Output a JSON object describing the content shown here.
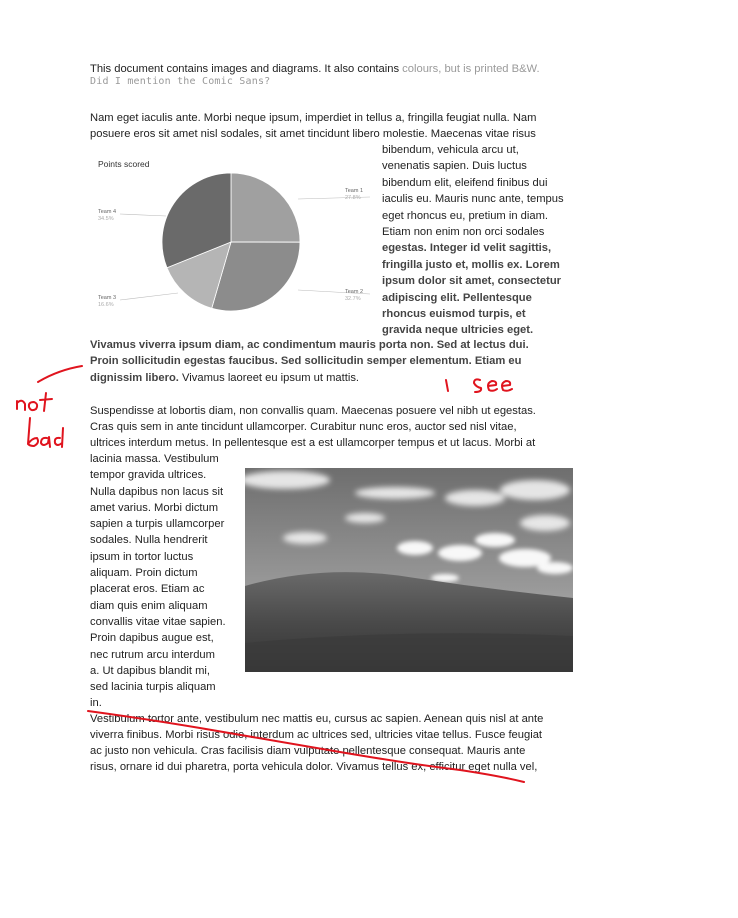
{
  "intro": {
    "line1_black": "This document contains images and diagrams. It also contains ",
    "line1_gray": "colours, but is printed B&W.",
    "line2": "Did I mention the Comic Sans?"
  },
  "para1": {
    "full_lines": [
      "Nam eget iaculis ante. Morbi neque ipsum, imperdiet in tellus a, fringilla feugiat nulla. Nam",
      "posuere eros sit amet nisl sodales, sit amet tincidunt libero molestie. Maecenas vitae risus"
    ],
    "wrap_lines": [
      "bibendum, vehicula arcu ut,",
      "venenatis sapien. Duis luctus",
      "bibendum elit, eleifend finibus dui",
      "iaculis eu. Mauris nunc ante, tempus",
      "eget rhoncus eu, pretium in diam.",
      "Etiam non enim non orci sodales",
      "egestas. Integer id velit sagittis,",
      "fringilla justo et, mollis ex. Lorem",
      "ipsum dolor sit amet, consectetur",
      "adipiscing elit. Pellentesque",
      "rhoncus euismod turpis, et",
      "gravida neque ultricies eget."
    ],
    "after_lines": [
      "Vivamus viverra ipsum diam, ac condimentum mauris porta non. Sed at lectus dui.",
      "Proin sollicitudin egestas faucibus. Sed sollicitudin semper elementum. Etiam eu"
    ],
    "last_bold": "dignissim libero.",
    "last_normal": " Vivamus laoreet eu ipsum ut mattis."
  },
  "chart_data": {
    "type": "pie",
    "title": "Points scored",
    "slices": [
      {
        "name": "Team 1",
        "value": 27.8,
        "label": "27.8%"
      },
      {
        "name": "Team 2",
        "value": 32.7,
        "label": "32.7%"
      },
      {
        "name": "Team 3",
        "value": 16.0,
        "label": "16.6%"
      },
      {
        "name": "Team 4",
        "value": 34.5,
        "label": "34.5%"
      }
    ],
    "colors": [
      "#a0a0a0",
      "#8c8c8c",
      "#b5b5b5",
      "#6a6a6a"
    ]
  },
  "para2": {
    "full_lines": [
      "Suspendisse at lobortis diam, non convallis quam. Maecenas posuere vel nibh ut egestas.",
      "Cras quis sem in ante tincidunt ullamcorper. Curabitur nunc eros, auctor sed nisl vitae,",
      "ultrices interdum metus. In pellentesque est a est ullamcorper tempus et ut lacus. Morbi at"
    ],
    "wrap_lines": [
      "lacinia massa. Vestibulum",
      "tempor gravida ultrices.",
      "Nulla dapibus non lacus sit",
      "amet varius. Morbi dictum",
      "sapien a turpis ullamcorper",
      "sodales. Nulla hendrerit",
      "ipsum in tortor luctus",
      "aliquam. Proin dictum",
      "placerat eros. Etiam ac",
      "diam quis enim aliquam",
      "convallis vitae vitae sapien.",
      "Proin dapibus augue est,",
      "nec rutrum arcu interdum",
      "a. Ut dapibus blandit mi,",
      "sed lacinia turpis aliquam",
      "in."
    ],
    "after_lines": [
      "Vestibulum tortor ante, vestibulum nec mattis eu, cursus ac sapien. Aenean quis nisl at ante",
      "viverra finibus. Morbi risus odio, interdum ac ultrices sed, ultricies vitae tellus. Fusce feugiat",
      "ac justo non vehicula. Cras facilisis diam vulputate pellentesque consequat. Mauris ante",
      "risus, ornare id dui pharetra, porta vehicula dolor. Vivamus tellus ex, efficitur eget nulla vel,"
    ]
  },
  "annotations": {
    "not_bad": "not bad",
    "i_see": "I see",
    "ink_color": "#e0141e"
  },
  "photo": {
    "subject": "grassy-hill-landscape"
  }
}
